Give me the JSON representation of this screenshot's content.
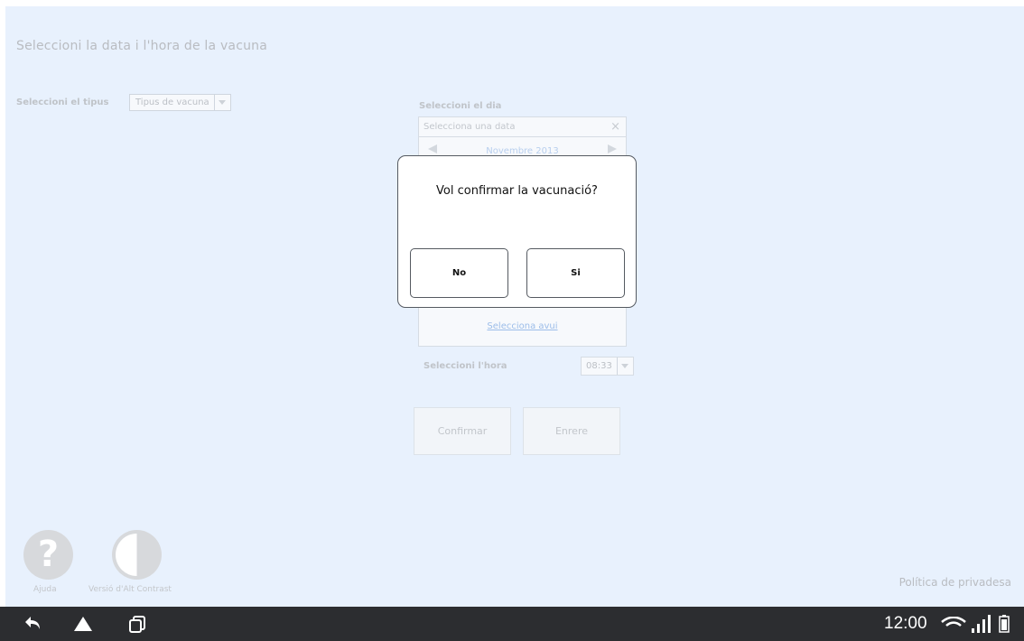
{
  "page": {
    "title": "Seleccioni  la data i l'hora  de la vacuna"
  },
  "type_selector": {
    "label": "Seleccioni el  tipus",
    "value": "Tipus de vacuna"
  },
  "date_selector": {
    "label": "Seleccioni el dia",
    "placeholder": "Selecciona una data",
    "clear_icon": "×",
    "calendar_month": "Novembre 2013",
    "today_link": "Selecciona avui"
  },
  "hour_selector": {
    "label": "Seleccioni l'hora",
    "value": "08:33"
  },
  "actions": {
    "confirm_label": "Confirmar",
    "back_label": "Enrere"
  },
  "footer": {
    "help_icon_glyph": "?",
    "help_label": "Ajuda",
    "contrast_label": "Versió d'Alt Contrast",
    "privacy_link": "Política de privadesa"
  },
  "dialog": {
    "message": "Vol confirmar la vacunació?",
    "no_label": "No",
    "yes_label": "Si"
  },
  "system_bar": {
    "time": "12:00"
  },
  "colors": {
    "background": "#e8f1fd",
    "navbar": "#2c2d30",
    "dialog_border": "#555a61"
  }
}
